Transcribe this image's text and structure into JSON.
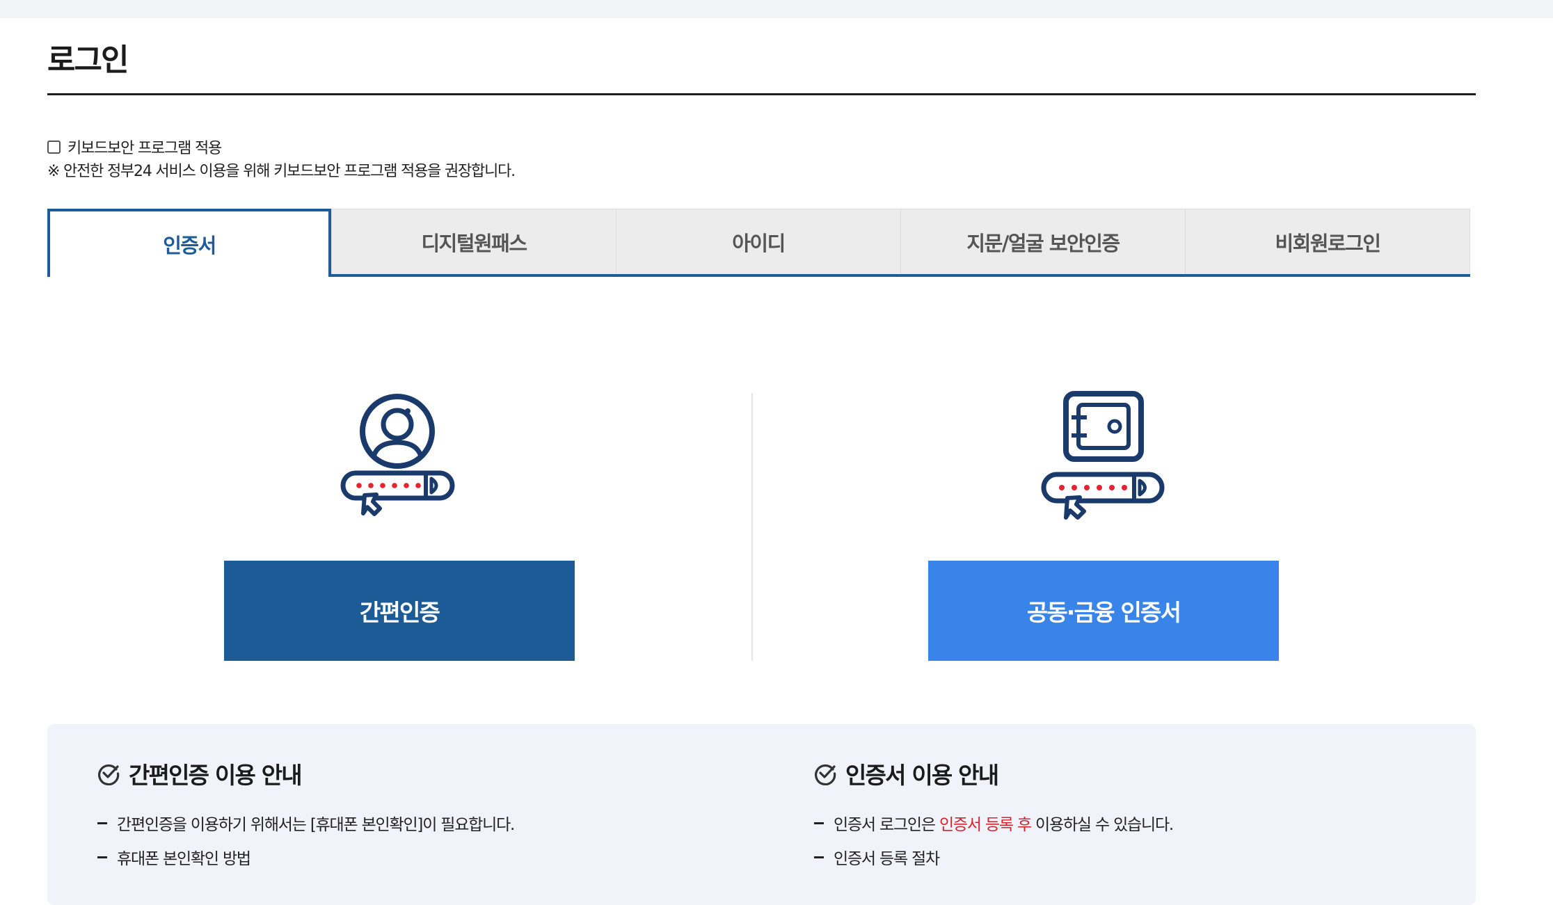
{
  "page": {
    "title": "로그인"
  },
  "keyboard_security": {
    "checkbox_label": "키보드보안 프로그램 적용",
    "checked": false,
    "note": "※ 안전한 정부24 서비스 이용을 위해 키보드보안 프로그램 적용을 권장합니다."
  },
  "tabs": [
    {
      "label": "인증서",
      "active": true
    },
    {
      "label": "디지털원패스",
      "active": false
    },
    {
      "label": "아이디",
      "active": false
    },
    {
      "label": "지문/얼굴 보안인증",
      "active": false
    },
    {
      "label": "비회원로그인",
      "active": false
    }
  ],
  "login_options": {
    "simple_auth": {
      "button_label": "간편인증",
      "icon": "user-password-icon"
    },
    "certificate": {
      "button_label": "공동·금융 인증서",
      "icon": "safe-password-icon"
    }
  },
  "guide": {
    "simple": {
      "title": "간편인증 이용 안내",
      "items": [
        "간편인증을 이용하기 위해서는 [휴대폰 본인확인]이 필요합니다.",
        "휴대폰 본인확인 방법"
      ]
    },
    "certificate": {
      "title": "인증서 이용 안내",
      "item1": {
        "before": "인증서 로그인은 ",
        "highlight": "인증서 등록 후",
        "after": " 이용하실 수 있습니다."
      },
      "item2": "인증서 등록 절차"
    }
  },
  "colors": {
    "primary_dark": "#1d5b96",
    "primary_light": "#3884e8",
    "highlight_red": "#d6222a",
    "guide_background": "#f1f3fa"
  }
}
